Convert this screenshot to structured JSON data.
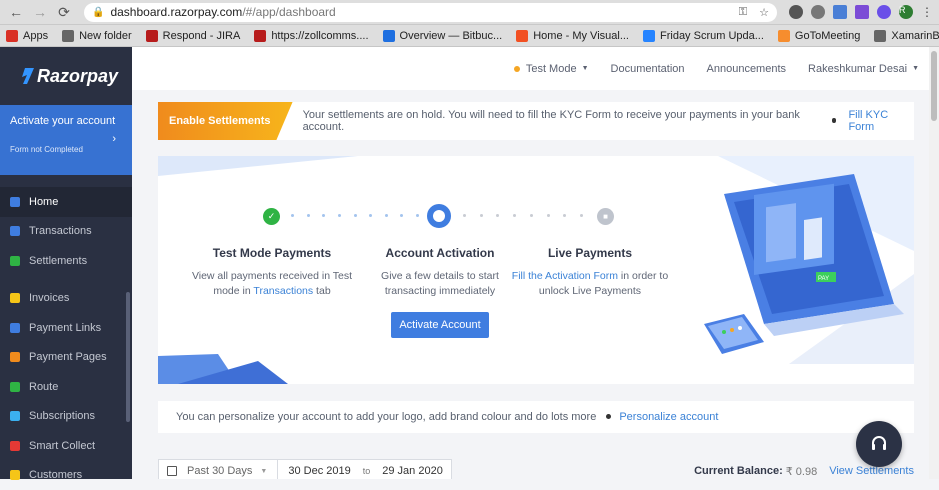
{
  "browser": {
    "url_host": "dashboard.razorpay.com",
    "url_path": "/#/app/dashboard",
    "profile_initial": "R",
    "bookmarks": [
      {
        "label": "Apps",
        "icon": "apps-grid-icon",
        "color": "#d93025"
      },
      {
        "label": "New folder",
        "icon": "folder-icon",
        "color": "#666666"
      },
      {
        "label": "Respond - JIRA",
        "icon": "zoll-icon",
        "color": "#b71c1c"
      },
      {
        "label": "https://zollcomms....",
        "icon": "zoll-icon",
        "color": "#b71c1c"
      },
      {
        "label": "Overview — Bitbuc...",
        "icon": "bitbucket-icon",
        "color": "#1e6fe0"
      },
      {
        "label": "Home - My Visual...",
        "icon": "microsoft-icon",
        "color": "#f25022"
      },
      {
        "label": "Friday Scrum Upda...",
        "icon": "jira-icon",
        "color": "#2684ff"
      },
      {
        "label": "GoToMeeting",
        "icon": "gotomeeting-icon",
        "color": "#f68d2e"
      },
      {
        "label": "XamarinBookMarks",
        "icon": "folder-icon",
        "color": "#666666"
      }
    ]
  },
  "sidebar": {
    "brand": "Razorpay",
    "activation": {
      "title": "Activate your account",
      "subtitle": "Form not Completed"
    },
    "items": [
      {
        "label": "Home",
        "color": "#3f7de0"
      },
      {
        "label": "Transactions",
        "color": "#3f7de0"
      },
      {
        "label": "Settlements",
        "color": "#2fb344"
      },
      {
        "label": "Invoices",
        "color": "#f5c518"
      },
      {
        "label": "Payment Links",
        "color": "#3f7de0"
      },
      {
        "label": "Payment Pages",
        "color": "#f08b1d"
      },
      {
        "label": "Route",
        "color": "#2fb344"
      },
      {
        "label": "Subscriptions",
        "color": "#3bb0f0"
      },
      {
        "label": "Smart Collect",
        "color": "#e53935"
      },
      {
        "label": "Customers",
        "color": "#f5c518"
      }
    ]
  },
  "topbar": {
    "mode": "Test Mode",
    "documentation": "Documentation",
    "announcements": "Announcements",
    "user": "Rakeshkumar Desai"
  },
  "notice": {
    "badge": "Enable Settlements",
    "message": "Your settlements are on hold. You will need to fill the KYC Form to receive your payments in your bank account.",
    "link": "Fill KYC Form"
  },
  "steps": [
    {
      "title": "Test Mode Payments",
      "text_pre": "View all payments received in Test mode in ",
      "link": "Transactions",
      "text_post": " tab"
    },
    {
      "title": "Account Activation",
      "text_pre": "Give a few details to start transacting immediately",
      "link": "",
      "text_post": ""
    },
    {
      "title": "Live Payments",
      "text_pre": "",
      "link": "Fill the Activation Form",
      "text_post": " in order to unlock Live Payments"
    }
  ],
  "activate_button": "Activate Account",
  "personalize": {
    "message": "You can personalize your account to add your logo, add brand colour and do lots more",
    "link": "Personalize account"
  },
  "filter": {
    "period": "Past 30 Days",
    "from": "30 Dec 2019",
    "to_word": "to",
    "to": "29 Jan 2020"
  },
  "balance": {
    "label": "Current Balance:",
    "value": "₹ 0.98",
    "link": "View Settlements"
  },
  "illustration_badge": "PAY"
}
